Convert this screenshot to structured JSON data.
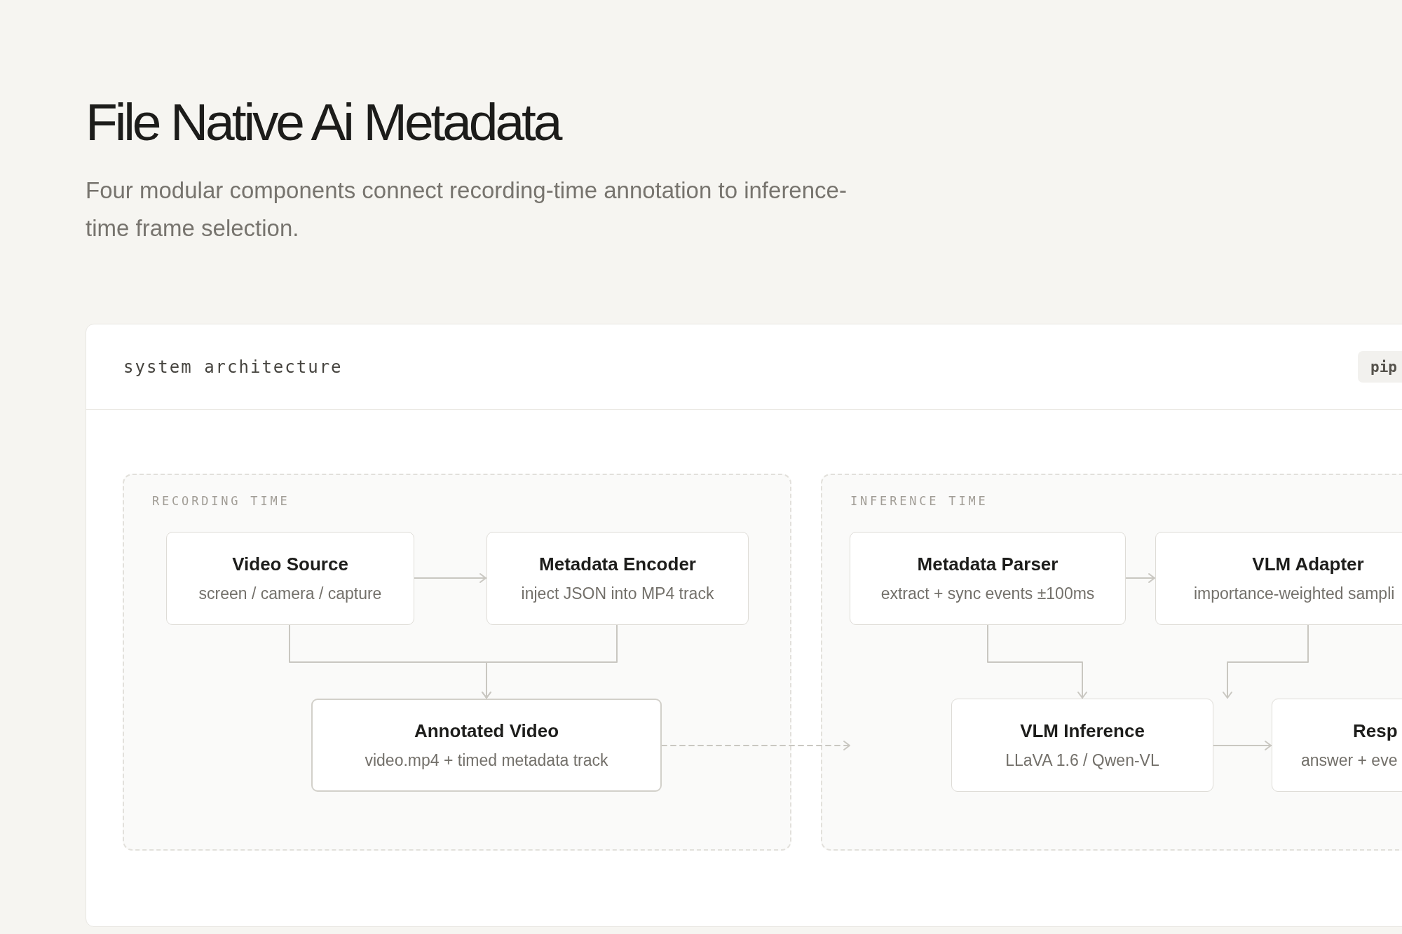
{
  "page": {
    "title": "File Native Ai Metadata",
    "subtitle": "Four modular components connect recording-time annotation to inference-time frame selection."
  },
  "card": {
    "title": "system architecture",
    "tag": "pip"
  },
  "diagram": {
    "groups": [
      {
        "label": "RECORDING TIME",
        "nodes": [
          {
            "title": "Video Source",
            "subtitle": "screen / camera / capture",
            "emphasized": false
          },
          {
            "title": "Metadata Encoder",
            "subtitle": "inject JSON into MP4 track",
            "emphasized": false
          },
          {
            "title": "Annotated Video",
            "subtitle": "video.mp4 + timed metadata track",
            "emphasized": true
          }
        ]
      },
      {
        "label": "INFERENCE TIME",
        "nodes": [
          {
            "title": "Metadata Parser",
            "subtitle": "extract + sync events ±100ms",
            "emphasized": false
          },
          {
            "title": "VLM Adapter",
            "subtitle": "importance-weighted sampli",
            "emphasized": false
          },
          {
            "title": "VLM Inference",
            "subtitle": "LLaVA 1.6 / Qwen-VL",
            "emphasized": false
          },
          {
            "title": "Resp",
            "subtitle": "answer + eve",
            "emphasized": false
          }
        ]
      }
    ],
    "connectors": [
      {
        "kind": "solid"
      },
      {
        "kind": "solid"
      },
      {
        "kind": "solid"
      },
      {
        "kind": "dashed"
      },
      {
        "kind": "solid"
      },
      {
        "kind": "solid"
      },
      {
        "kind": "solid"
      },
      {
        "kind": "solid"
      }
    ]
  }
}
